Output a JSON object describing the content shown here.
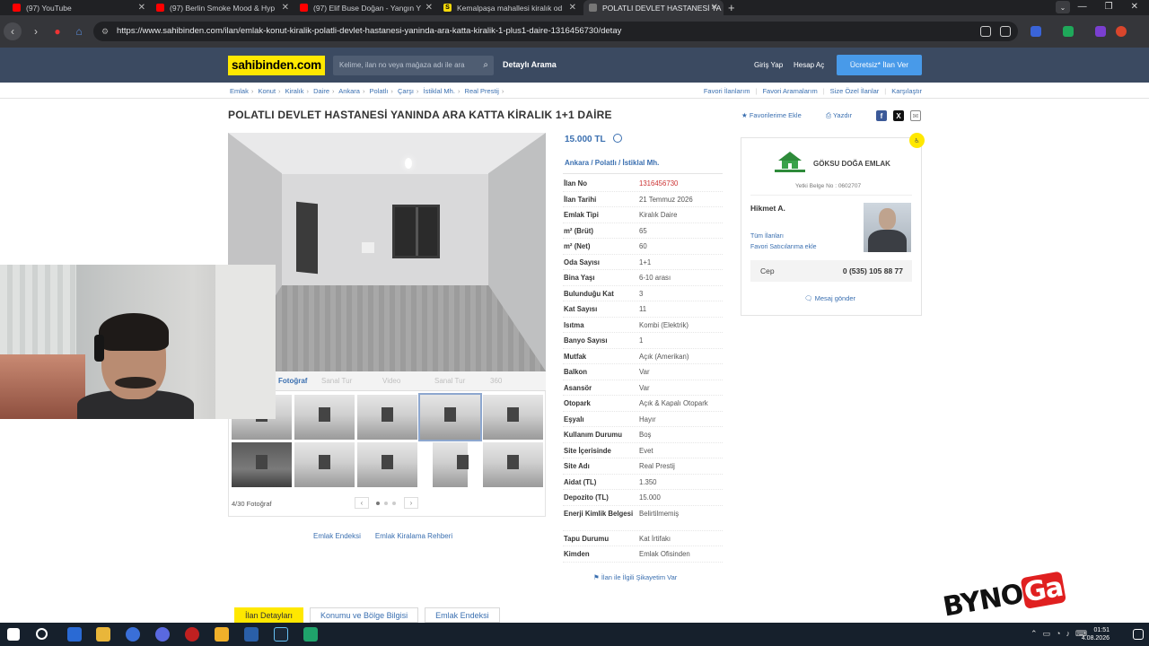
{
  "browser": {
    "tabs": [
      {
        "title": "(97) YouTube",
        "icon": "youtube-icon"
      },
      {
        "title": "(97) Berlin Smoke Mood & Hyp",
        "icon": "youtube-icon"
      },
      {
        "title": "(97) Elif Buse Doğan - Yangın Y",
        "icon": "youtube-icon"
      },
      {
        "title": "Kemalpaşa mahallesi kiralık od",
        "icon": "sahibinden-icon"
      },
      {
        "title": "POLATLI DEVLET HASTANESİ YA",
        "icon": "page-icon"
      }
    ],
    "url": "https://www.sahibinden.com/ilan/emlak-konut-kiralik-polatli-devlet-hastanesi-yaninda-ara-katta-kiralik-1-plus1-daire-1316456730/detay"
  },
  "site": {
    "logo": "sahibinden.com",
    "search_placeholder": "Kelime, ilan no veya mağaza adı ile ara",
    "detailed_search": "Detaylı Arama",
    "login": "Giriş Yap",
    "register": "Hesap Aç",
    "post_ad": "Ücretsiz* İlan Ver"
  },
  "breadcrumb": [
    "Emlak",
    "Konut",
    "Kiralık",
    "Daire",
    "Ankara",
    "Polatlı",
    "Çarşı",
    "İstiklal Mh.",
    "Real Prestij"
  ],
  "top_links": [
    "Favori İlanlarım",
    "Favori Aramalarım",
    "Size Özel İlanlar",
    "Karşılaştır"
  ],
  "listing": {
    "title": "POLATLI DEVLET HASTANESİ YANINDA ARA KATTA KİRALIK 1+1 DAİRE",
    "add_favorite": "Favorilerime Ekle",
    "print": "Yazdır",
    "price": "15.000 TL",
    "location": "Ankara  /  Polatlı  /  İstiklal Mh.",
    "photo_tabs": [
      "Fotoğraf",
      "Sanal Tur",
      "Video",
      "Sanal Tur",
      "360"
    ],
    "photo_count": "4/30 Fotoğraf",
    "below_links": [
      "Emlak Endeksi",
      "Emlak Kiralama Rehberi"
    ],
    "properties": [
      {
        "k": "İlan No",
        "v": "1316456730"
      },
      {
        "k": "İlan Tarihi",
        "v": "21 Temmuz 2026"
      },
      {
        "k": "Emlak Tipi",
        "v": "Kiralık Daire"
      },
      {
        "k": "m² (Brüt)",
        "v": "65"
      },
      {
        "k": "m² (Net)",
        "v": "60"
      },
      {
        "k": "Oda Sayısı",
        "v": "1+1"
      },
      {
        "k": "Bina Yaşı",
        "v": "6-10 arası"
      },
      {
        "k": "Bulunduğu Kat",
        "v": "3"
      },
      {
        "k": "Kat Sayısı",
        "v": "11"
      },
      {
        "k": "Isıtma",
        "v": "Kombi (Elektrik)"
      },
      {
        "k": "Banyo Sayısı",
        "v": "1"
      },
      {
        "k": "Mutfak",
        "v": "Açık (Amerikan)"
      },
      {
        "k": "Balkon",
        "v": "Var"
      },
      {
        "k": "Asansör",
        "v": "Var"
      },
      {
        "k": "Otopark",
        "v": "Açık & Kapalı Otopark"
      },
      {
        "k": "Eşyalı",
        "v": "Hayır"
      },
      {
        "k": "Kullanım Durumu",
        "v": "Boş"
      },
      {
        "k": "Site İçerisinde",
        "v": "Evet"
      },
      {
        "k": "Site Adı",
        "v": "Real Prestij"
      },
      {
        "k": "Aidat (TL)",
        "v": "1.350"
      },
      {
        "k": "Depozito (TL)",
        "v": "15.000"
      },
      {
        "k": "Enerji Kimlik Belgesi",
        "v": "Belirtilmemiş"
      },
      {
        "k": "Tapu Durumu",
        "v": "Kat İrtifakı"
      },
      {
        "k": "Kimden",
        "v": "Emlak Ofisinden"
      }
    ],
    "complaint": "İlan ile İlgili Şikayetim Var"
  },
  "seller": {
    "firm": "GÖKSU DOĞA EMLAK",
    "license": "Yetki Belge No : 0602707",
    "name": "Hikmet A.",
    "all_ads": "Tüm İlanları",
    "add_fav": "Favori Satıcılarıma ekle",
    "phone_label": "Cep",
    "phone": "0 (535) 105 88 77",
    "message": "Mesaj gönder"
  },
  "bottom_tabs": [
    "İlan Detayları",
    "Konumu ve Bölge Bilgisi",
    "Emlak Endeksi"
  ],
  "taskbar": {
    "time": "01:51",
    "date": "4.08.2026"
  },
  "colors": {
    "brand_yellow": "#ffe800",
    "header_navy": "#3b4a61",
    "link_blue": "#3a6fb0",
    "cta_blue": "#489ae9"
  }
}
